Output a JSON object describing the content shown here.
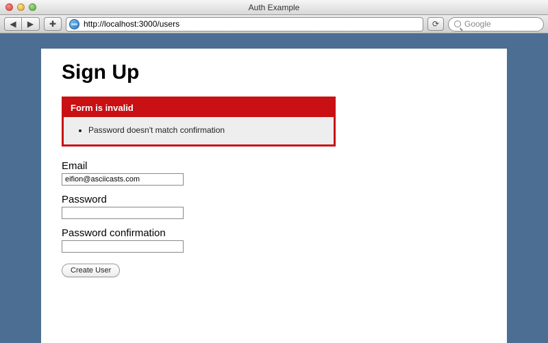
{
  "window": {
    "title": "Auth Example"
  },
  "toolbar": {
    "back_glyph": "◀",
    "forward_glyph": "▶",
    "add_glyph": "✚",
    "reload_glyph": "⟳",
    "url": "http://localhost:3000/users",
    "search_placeholder": "Google"
  },
  "page": {
    "heading": "Sign Up",
    "error": {
      "title": "Form is invalid",
      "messages": [
        "Password doesn't match confirmation"
      ]
    },
    "fields": {
      "email": {
        "label": "Email",
        "value": "eifion@asciicasts.com"
      },
      "password": {
        "label": "Password",
        "value": ""
      },
      "password_confirmation": {
        "label": "Password confirmation",
        "value": ""
      }
    },
    "submit_label": "Create User"
  }
}
